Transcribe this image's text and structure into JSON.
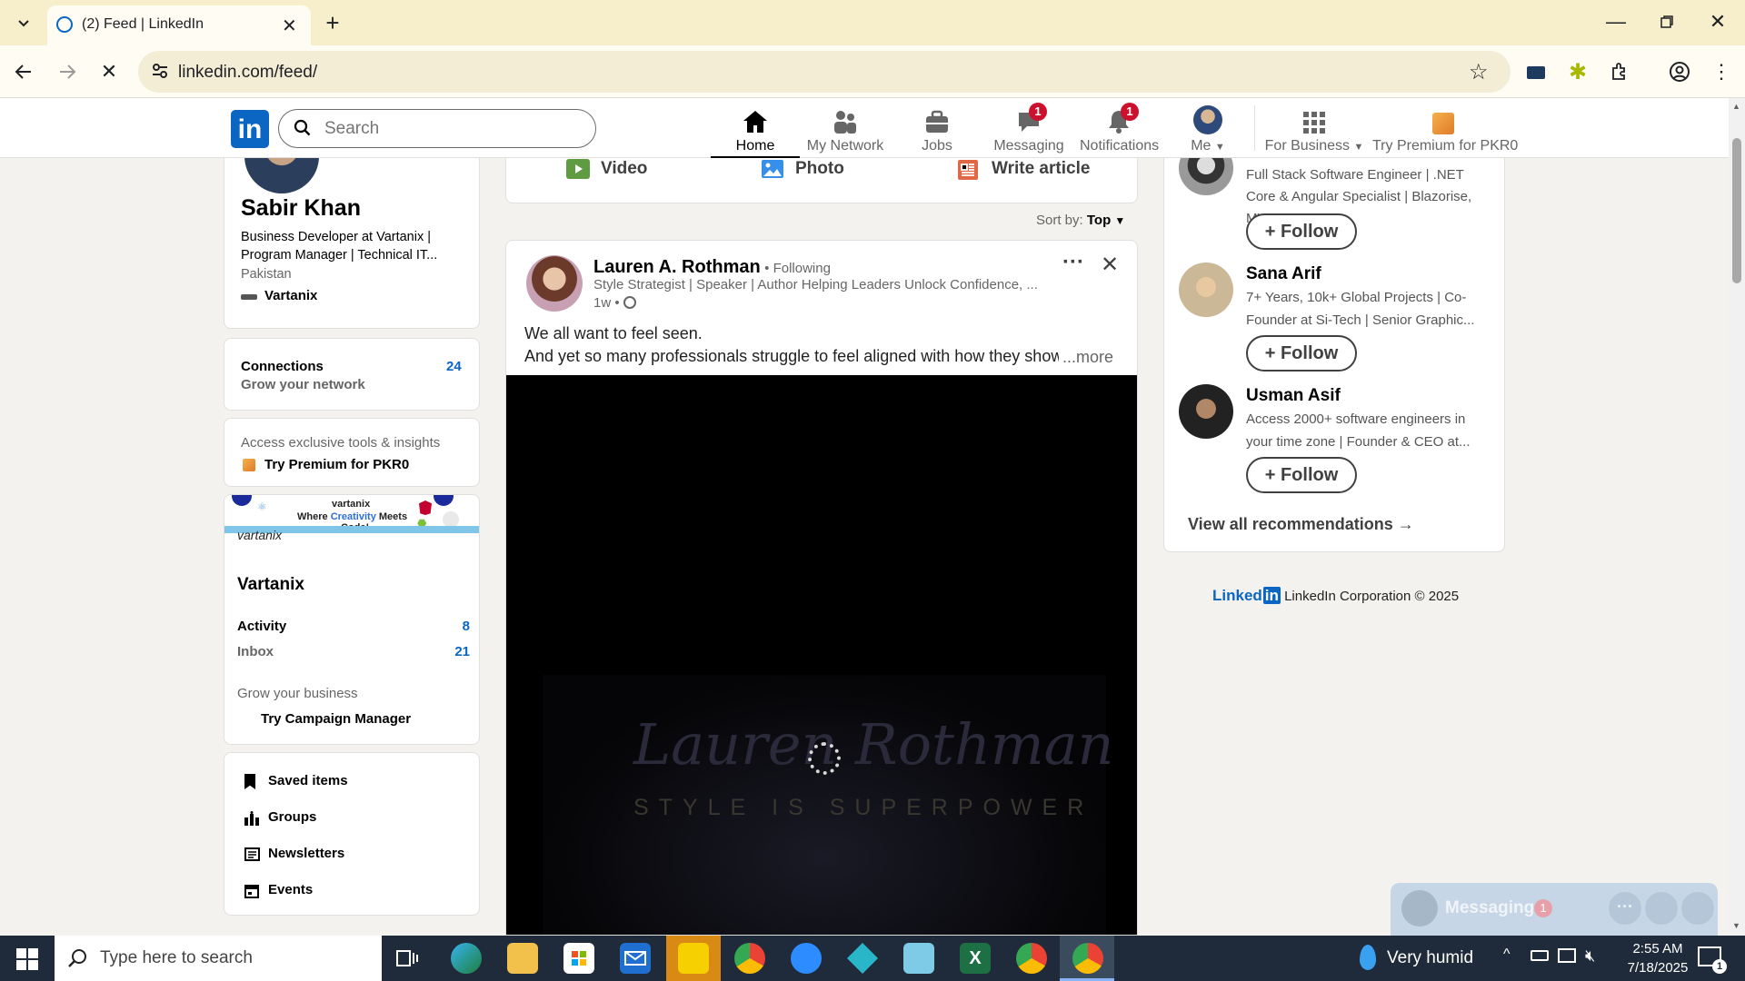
{
  "browser": {
    "tab_title": "(2) Feed | LinkedIn",
    "url": "linkedin.com/feed/"
  },
  "nav": {
    "search_placeholder": "Search",
    "home": "Home",
    "network": "My Network",
    "jobs": "Jobs",
    "messaging": "Messaging",
    "messaging_badge": "1",
    "notifications": "Notifications",
    "notifications_badge": "1",
    "me": "Me",
    "business": "For Business",
    "premium": "Try Premium for PKR0"
  },
  "profile": {
    "name": "Sabir Khan",
    "headline": "Business Developer at Vartanix | Program Manager | Technical IT...",
    "location": "Pakistan",
    "company": "Vartanix",
    "connections_label": "Connections",
    "connections_sub": "Grow your network",
    "connections_count": "24",
    "premium_text": "Access exclusive tools & insights",
    "premium_link": "Try Premium for PKR0"
  },
  "page_card": {
    "banner_brand": "vartanix",
    "banner_tagline_1": "Where",
    "banner_tagline_2": "Creativity",
    "banner_tagline_3": "Meets",
    "banner_tagline_4": "Code!",
    "banner_logo": "vartanix",
    "name": "Vartanix",
    "activity_label": "Activity",
    "activity_count": "8",
    "inbox_label": "Inbox",
    "inbox_count": "21",
    "grow_text": "Grow your business",
    "campaign_link": "Try Campaign Manager"
  },
  "shortcuts": [
    {
      "label": "Saved items"
    },
    {
      "label": "Groups"
    },
    {
      "label": "Newsletters"
    },
    {
      "label": "Events"
    }
  ],
  "composer": {
    "video": "Video",
    "photo": "Photo",
    "article": "Write article"
  },
  "sort": {
    "label": "Sort by:",
    "value": "Top"
  },
  "post": {
    "author": "Lauren A. Rothman",
    "following": "• Following",
    "headline": "Style Strategist | Speaker | Author Helping Leaders Unlock Confidence, ...",
    "time": "1w •",
    "line1": "We all want to feel seen.",
    "line2": "And yet so many professionals struggle to feel aligned with how they show",
    "more": "...more",
    "video_script": "Lauren Rothman",
    "video_tagline": "STYLE IS SUPERPOWER"
  },
  "recommendations": [
    {
      "name": "",
      "headline": "Full Stack Software Engineer | .NET Core & Angular Specialist | Blazorise, MVC,...",
      "follow": "Follow"
    },
    {
      "name": "Sana Arif",
      "headline": "7+ Years, 10k+ Global Projects | Co-Founder at Si-Tech | Senior Graphic...",
      "follow": "Follow"
    },
    {
      "name": "Usman Asif",
      "headline": "Access 2000+ software engineers in your time zone | Founder & CEO at...",
      "follow": "Follow"
    }
  ],
  "view_all": "View all recommendations →",
  "footer": {
    "brand": "Linked",
    "brand_in": "in",
    "text": "LinkedIn Corporation © 2025"
  },
  "messaging_bar": {
    "label": "Messaging",
    "count": "1"
  },
  "taskbar": {
    "search_placeholder": "Type here to search",
    "weather": "Very humid",
    "time": "2:55 AM",
    "date": "7/18/2025",
    "notif_count": "1"
  }
}
